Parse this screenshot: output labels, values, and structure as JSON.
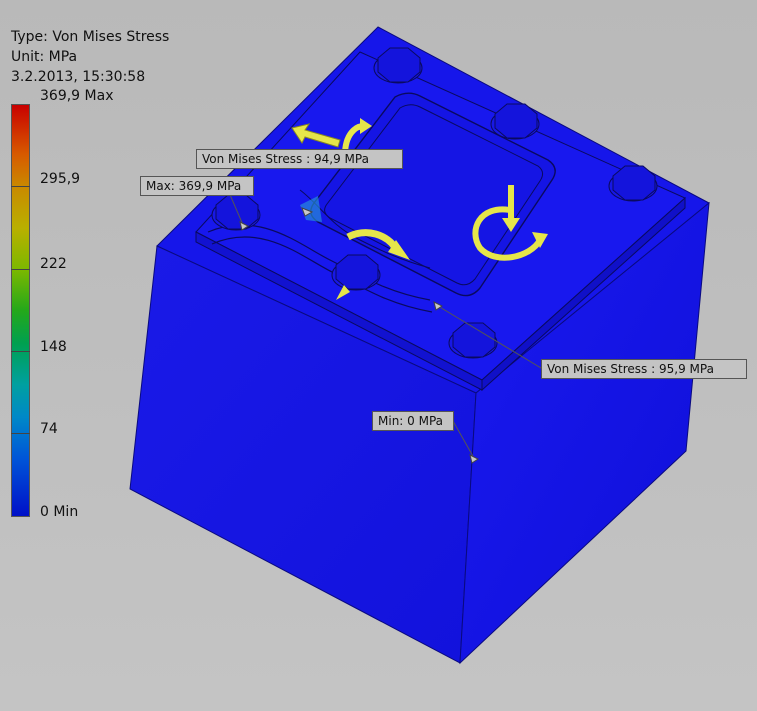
{
  "legend": {
    "type_line": "Type: Von Mises Stress",
    "unit_line": "Unit: MPa",
    "date_line": "3.2.2013, 15:30:58"
  },
  "color_scale": {
    "max_label": "369,9 Max",
    "ticks": [
      "295,9",
      "222",
      "148",
      "74"
    ],
    "min_label": "0 Min",
    "colors": {
      "max": "#c80000",
      "high": "#c98a00",
      "mid": "#24a81a",
      "low": "#00a0a0",
      "min": "#0010c8"
    }
  },
  "model": {
    "body_color": "#1414e6",
    "load_arrow_color": "#e6e64a"
  },
  "probes": {
    "probe_1": "Von Mises Stress : 94,9 MPa",
    "probe_2": "Von Mises Stress : 95,9 MPa",
    "max": "Max: 369,9 MPa",
    "min": "Min: 0 MPa"
  }
}
